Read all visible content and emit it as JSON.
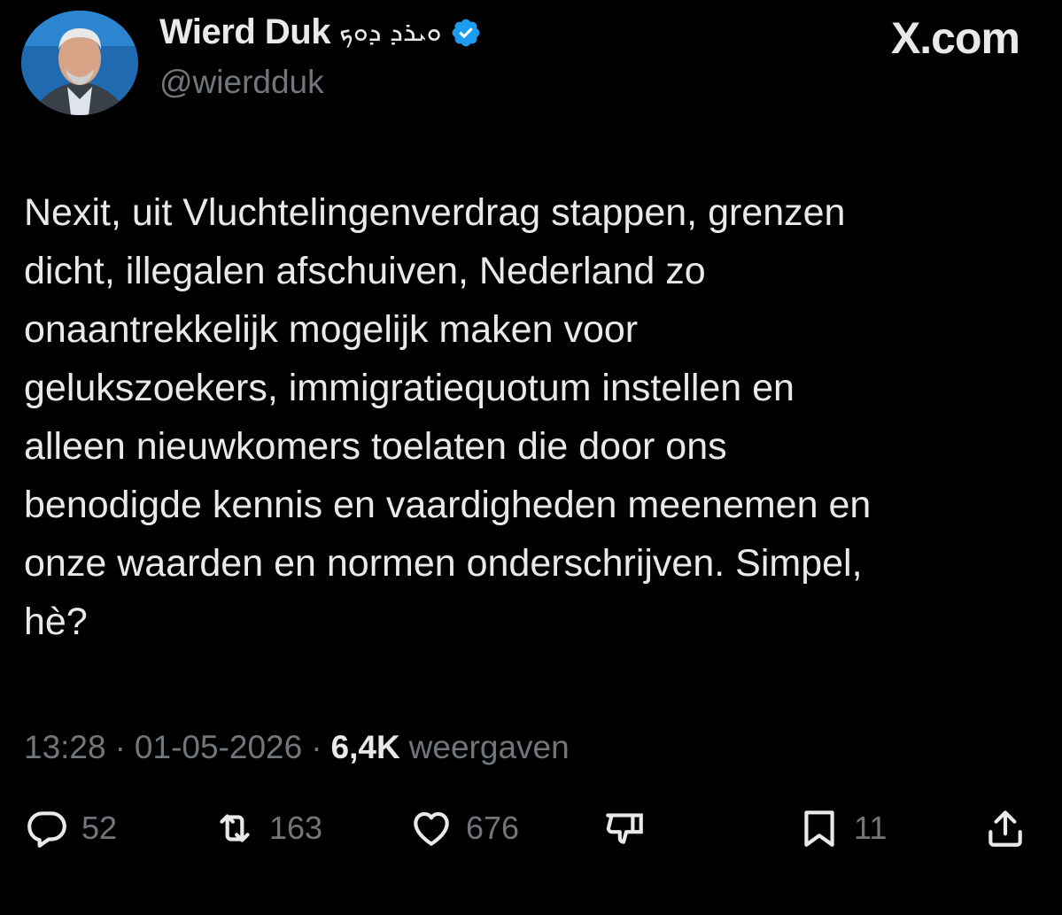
{
  "header": {
    "display_name": "Wierd Duk",
    "name_glyphs": "ܘܝܪܕ ܕܘܟ",
    "handle": "@wierdduk",
    "brand": "X.com"
  },
  "tweet": {
    "text": "Nexit,  uit Vluchtelingenverdrag stappen, grenzen\ndicht, illegalen afschuiven, Nederland zo\nonaantrekkelijk mogelijk maken voor\ngelukszoekers, immigratiequotum instellen en\nalleen nieuwkomers toelaten die door ons\nbenodigde kennis en vaardigheden meenemen en\nonze waarden en normen onderschrijven. Simpel,\nhè?",
    "time": "13:28",
    "sep": "·",
    "date": "01-05-2026",
    "views_count": "6,4K",
    "views_label": "weergaven"
  },
  "actions": {
    "replies": "52",
    "reposts": "163",
    "likes": "676",
    "bookmarks": "11"
  },
  "icons": {
    "verified": "verified-badge-icon",
    "reply": "reply-icon",
    "repost": "repost-icon",
    "like": "heart-icon",
    "downvote": "downvote-icon",
    "bookmark": "bookmark-icon",
    "share": "share-icon"
  },
  "colors": {
    "background": "#000000",
    "text": "#e7e9ea",
    "muted": "#71767b",
    "verified": "#1d9bf0"
  }
}
